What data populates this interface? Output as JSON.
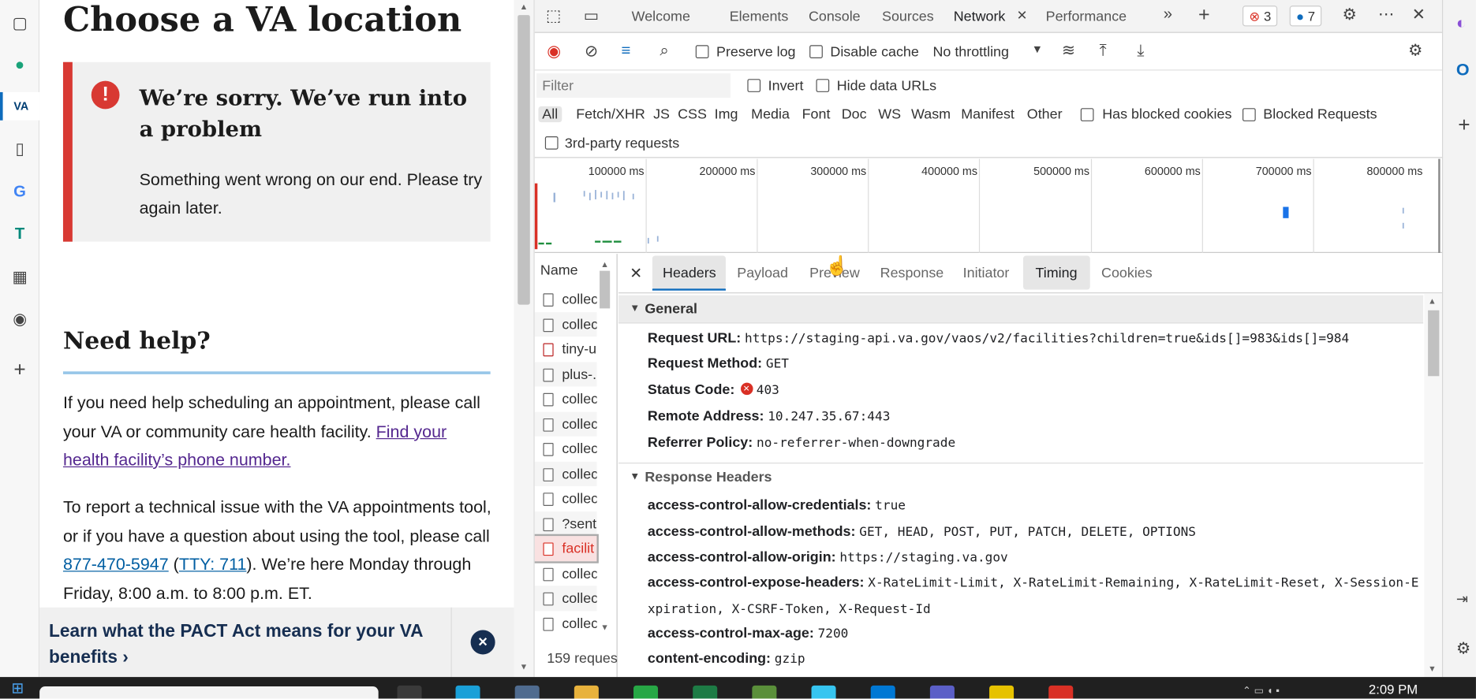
{
  "page": {
    "heading": "Choose a VA location",
    "alert_title": "We’re sorry. We’ve run into a problem",
    "alert_body": "Something went wrong on our end. Please try again later.",
    "help_heading": "Need help?",
    "help_p1": "If you need help scheduling an appointment, please call your VA or community care health facility.",
    "help_link": "Find your health facility’s phone number.",
    "help_p2_a": "To report a technical issue with the VA appointments tool, or if you have a question about using the tool, please call",
    "phone": "877-470-5947",
    "tty": "TTY: 711",
    "help_p2_b": ". We’re here Monday through Friday, 8:00 a.m. to 8:00 p.m. ET.",
    "pact_banner": "Learn what the PACT Act means for your VA benefits ›"
  },
  "devtools": {
    "tabs": [
      "Welcome",
      "Elements",
      "Console",
      "Sources",
      "Network",
      "Performance"
    ],
    "active_tab": "Network",
    "error_count": "3",
    "message_count": "7",
    "toolbar": {
      "preserve_log": "Preserve log",
      "disable_cache": "Disable cache",
      "throttling": "No throttling"
    },
    "filter_placeholder": "Filter",
    "invert": "Invert",
    "hide_data_urls": "Hide data URLs",
    "types": [
      "All",
      "Fetch/XHR",
      "JS",
      "CSS",
      "Img",
      "Media",
      "Font",
      "Doc",
      "WS",
      "Wasm",
      "Manifest",
      "Other"
    ],
    "has_blocked_cookies": "Has blocked cookies",
    "blocked_requests": "Blocked Requests",
    "third_party": "3rd-party requests",
    "timeline_ticks": [
      "100000 ms",
      "200000 ms",
      "300000 ms",
      "400000 ms",
      "500000 ms",
      "600000 ms",
      "700000 ms",
      "800000 ms"
    ],
    "requests": {
      "header": "Name",
      "items": [
        "collec",
        "collec",
        "tiny-u",
        "plus-.",
        "collec",
        "collec",
        "collec",
        "collec",
        "collec",
        "?sent",
        "facilit",
        "collec",
        "collec",
        "collec"
      ],
      "footer": "159 reques"
    },
    "detail_tabs": [
      "Headers",
      "Payload",
      "Preview",
      "Response",
      "Initiator",
      "Timing",
      "Cookies"
    ],
    "general": {
      "title": "General",
      "request_url_k": "Request URL:",
      "request_url_v": "https://staging-api.va.gov/vaos/v2/facilities?children=true&ids[]=983&ids[]=984",
      "method_k": "Request Method:",
      "method_v": "GET",
      "status_k": "Status Code:",
      "status_v": "403",
      "remote_k": "Remote Address:",
      "remote_v": "10.247.35.67:443",
      "referrer_k": "Referrer Policy:",
      "referrer_v": "no-referrer-when-downgrade"
    },
    "response_headers": {
      "title": "Response Headers",
      "h1_k": "access-control-allow-credentials:",
      "h1_v": "true",
      "h2_k": "access-control-allow-methods:",
      "h2_v": "GET, HEAD, POST, PUT, PATCH, DELETE, OPTIONS",
      "h3_k": "access-control-allow-origin:",
      "h3_v": "https://staging.va.gov",
      "h4_k": "access-control-expose-headers:",
      "h4_v": "X-RateLimit-Limit, X-RateLimit-Remaining, X-RateLimit-Reset, X-Session-Expiration, X-CSRF-Token, X-Request-Id",
      "h5_k": "access-control-max-age:",
      "h5_v": "7200",
      "h6_k": "content-encoding:",
      "h6_v": "gzip"
    }
  },
  "taskbar": {
    "time": "2:09 PM"
  }
}
